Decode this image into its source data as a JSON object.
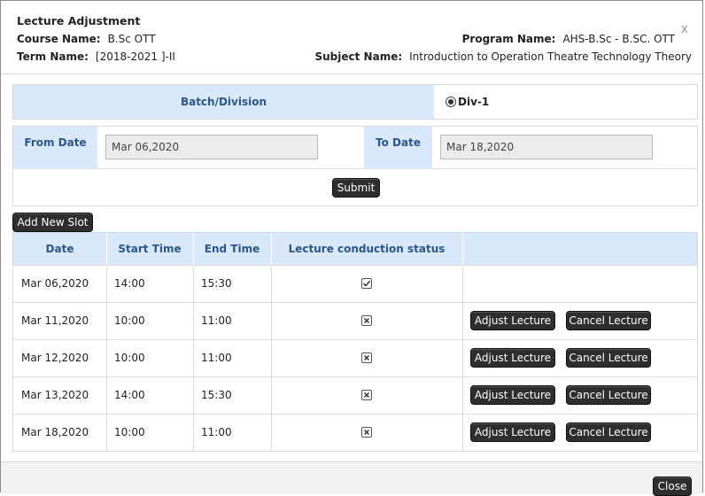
{
  "dialog": {
    "title": "Lecture Adjustment",
    "course_label": "Course Name:",
    "course_value": "B.Sc OTT",
    "term_label": "Term Name:",
    "term_value": "[2018-2021 ]-II",
    "program_label": "Program Name:",
    "program_value": "AHS-B.Sc - B.SC. OTT",
    "subject_label": "Subject Name:",
    "subject_value": "Introduction to Operation Theatre Technology Theory",
    "close_x": "x"
  },
  "batch": {
    "label": "Batch/Division",
    "options": [
      {
        "label": "Div-1",
        "selected": true
      }
    ]
  },
  "dates": {
    "from_label": "From Date",
    "from_value": "Mar 06,2020",
    "to_label": "To Date",
    "to_value": "Mar 18,2020",
    "submit_label": "Submit"
  },
  "add_slot_label": "Add New Slot",
  "table": {
    "headers": [
      "Date",
      "Start Time",
      "End Time",
      "Lecture conduction status",
      ""
    ],
    "rows": [
      {
        "date": "Mar 06,2020",
        "start": "14:00",
        "end": "15:30",
        "status": "conducted",
        "adjust": "",
        "cancel": ""
      },
      {
        "date": "Mar 11,2020",
        "start": "10:00",
        "end": "11:00",
        "status": "not-conducted",
        "adjust": "Adjust Lecture",
        "cancel": "Cancel Lecture"
      },
      {
        "date": "Mar 12,2020",
        "start": "10:00",
        "end": "11:00",
        "status": "not-conducted",
        "adjust": "Adjust Lecture",
        "cancel": "Cancel Lecture"
      },
      {
        "date": "Mar 13,2020",
        "start": "14:00",
        "end": "15:30",
        "status": "not-conducted",
        "adjust": "Adjust Lecture",
        "cancel": "Cancel Lecture"
      },
      {
        "date": "Mar 18,2020",
        "start": "10:00",
        "end": "11:00",
        "status": "not-conducted",
        "adjust": "Adjust Lecture",
        "cancel": "Cancel Lecture"
      }
    ]
  },
  "footer": {
    "close_label": "Close"
  },
  "colors": {
    "header_fill": "#d9e9fb",
    "header_text": "#2a5688",
    "button_bg": "#2e2e2e"
  }
}
